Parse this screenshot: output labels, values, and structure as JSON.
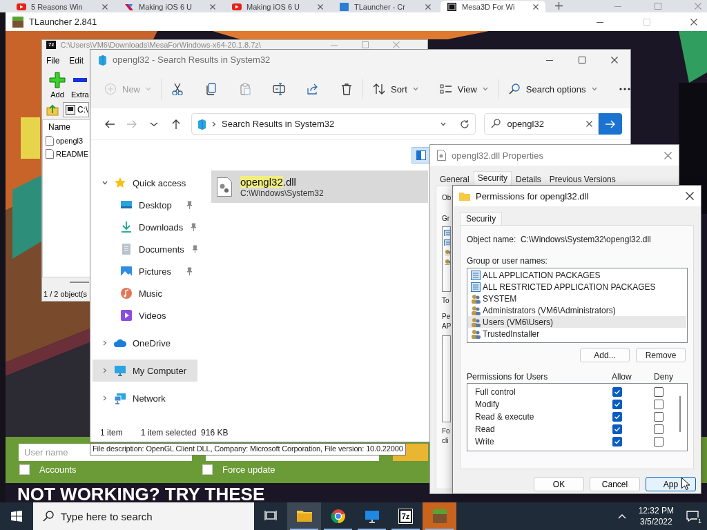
{
  "browser_tabs": [
    {
      "title": "5 Reasons Win",
      "selected": false
    },
    {
      "title": "Making iOS 6 U",
      "selected": false
    },
    {
      "title": "Making iOS 6 U",
      "selected": false
    },
    {
      "title": "TLauncher - Cr",
      "selected": false
    },
    {
      "title": "Mesa3D For Wi",
      "selected": true
    }
  ],
  "tlauncher": {
    "title": "TLauncher 2.841",
    "username": {
      "placeholder": "User name"
    },
    "accounts": {
      "label": "Accounts",
      "checked": false
    },
    "force_update": {
      "label": "Force update",
      "checked": false
    },
    "banner": "NOT WORKING? TRY THESE"
  },
  "zip_window": {
    "logo": "7z",
    "title": "C:\\Users\\VM6\\Downloads\\MesaForWindows-x64-20.1.8.7z\\",
    "menu": [
      "File",
      "Edit"
    ],
    "toolbar": [
      "Add",
      "Extra"
    ],
    "path": "C:\\",
    "column": "Name",
    "files": [
      "opengl3",
      "README"
    ],
    "status": "1 / 2 object(s"
  },
  "explorer": {
    "title": "opengl32 - Search Results in System32",
    "toolbar_groups": [
      [
        {
          "kind": "menu",
          "label": "New",
          "disabled": true
        }
      ],
      [
        {
          "kind": "icon",
          "disabled": false
        },
        {
          "kind": "icon",
          "disabled": false
        },
        {
          "kind": "icon",
          "disabled": true
        },
        {
          "kind": "icon",
          "disabled": false
        },
        {
          "kind": "icon",
          "disabled": false
        },
        {
          "kind": "icon",
          "disabled": false
        }
      ],
      [
        {
          "kind": "menu",
          "label": "Sort",
          "disabled": false
        },
        {
          "kind": "menu",
          "label": "View",
          "disabled": false
        }
      ],
      [
        {
          "kind": "menu",
          "label": "Search options",
          "disabled": false
        },
        {
          "kind": "icon",
          "disabled": false
        }
      ]
    ],
    "nav_buttons": [
      {
        "disabled": false
      },
      {
        "disabled": true
      },
      {
        "disabled": false
      },
      {
        "disabled": false
      }
    ],
    "address": "Search Results in System32",
    "search": "opengl32",
    "nav": [
      {
        "label": "Quick access",
        "expanded": true,
        "selected": false,
        "children": [
          {
            "label": "Desktop",
            "pinned": true,
            "selected": false
          },
          {
            "label": "Downloads",
            "pinned": true,
            "selected": false
          },
          {
            "label": "Documents",
            "pinned": true,
            "selected": false
          },
          {
            "label": "Pictures",
            "pinned": true,
            "selected": false
          },
          {
            "label": "Music",
            "pinned": false,
            "selected": false
          },
          {
            "label": "Videos",
            "pinned": false,
            "selected": false
          }
        ]
      },
      {
        "label": "OneDrive",
        "expanded": false,
        "selected": false
      },
      {
        "label": "My Computer",
        "expanded": false,
        "selected": true
      },
      {
        "label": "Network",
        "expanded": false,
        "selected": false
      }
    ],
    "file": {
      "name_match": "opengl32",
      "name_rest": ".dll",
      "path": "C:\\Windows\\System32",
      "selected": true
    },
    "status": [
      "1 item",
      "1 item selected  916 KB"
    ],
    "tooltip": "File description: OpenGL Client DLL, Company: Microsoft Corporation, File version: 10.0.22000"
  },
  "properties": {
    "title": "opengl32.dll Properties",
    "tabs": [
      {
        "label": "General",
        "selected": false
      },
      {
        "label": "Security",
        "selected": true
      },
      {
        "label": "Details",
        "selected": false
      },
      {
        "label": "Previous Versions",
        "selected": false
      }
    ],
    "fragments": [
      "Ob",
      "Gr",
      "To",
      "Pe",
      "AP",
      "Fo",
      "cli"
    ]
  },
  "permissions": {
    "title": "Permissions for opengl32.dll",
    "tab": "Security",
    "object_label": "Object name:",
    "object_value": "C:\\Windows\\System32\\opengl32.dll",
    "group_label": "Group or user names:",
    "users": [
      {
        "name": "ALL APPLICATION PACKAGES",
        "kind": "package",
        "selected": false
      },
      {
        "name": "ALL RESTRICTED APPLICATION PACKAGES",
        "kind": "package",
        "selected": false
      },
      {
        "name": "SYSTEM",
        "kind": "group",
        "selected": false
      },
      {
        "name": "Administrators (VM6\\Administrators)",
        "kind": "group",
        "selected": false
      },
      {
        "name": "Users (VM6\\Users)",
        "kind": "group",
        "selected": true
      },
      {
        "name": "TrustedInstaller",
        "kind": "group",
        "selected": false
      }
    ],
    "user_buttons": [
      "Add...",
      "Remove"
    ],
    "perm_label": "Permissions for Users",
    "allow_label": "Allow",
    "deny_label": "Deny",
    "perms": [
      {
        "name": "Full control",
        "allow": true,
        "deny": false
      },
      {
        "name": "Modify",
        "allow": true,
        "deny": false
      },
      {
        "name": "Read & execute",
        "allow": true,
        "deny": false
      },
      {
        "name": "Read",
        "allow": true,
        "deny": false
      },
      {
        "name": "Write",
        "allow": true,
        "deny": false
      }
    ],
    "buttons": [
      "OK",
      "Cancel",
      "App"
    ]
  },
  "taskbar": {
    "search": {
      "placeholder": "Type here to search"
    },
    "zip_logo": "7z",
    "apps": [
      {
        "running": true,
        "highlighted": true
      },
      {
        "running": true,
        "highlighted": false
      },
      {
        "running": true,
        "highlighted": false
      },
      {
        "running": true,
        "highlighted": false
      },
      {
        "running": true,
        "highlighted": true
      }
    ],
    "time": "12:32 PM",
    "date": "3/5/2022",
    "notifications": "1"
  }
}
